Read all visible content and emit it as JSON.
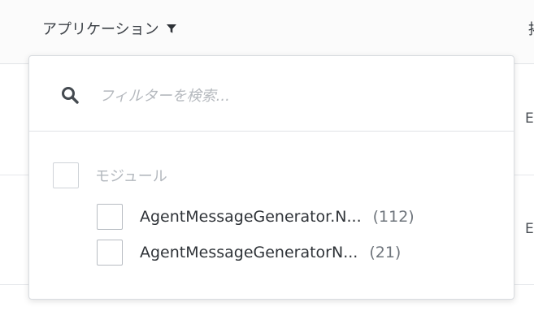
{
  "header": {
    "column_title": "アプリケーション",
    "next_column_partial": "掲"
  },
  "rows": [
    {
      "partial_text": "E"
    },
    {
      "partial_text": "E"
    }
  ],
  "filter_popover": {
    "search": {
      "placeholder": "フィルターを検索...",
      "value": ""
    },
    "group": {
      "label": "モジュール",
      "checked": false
    },
    "items": [
      {
        "label": "AgentMessageGenerator.N...",
        "count": "(112)",
        "checked": false
      },
      {
        "label": "AgentMessageGeneratorN...",
        "count": "(21)",
        "checked": false
      }
    ]
  }
}
